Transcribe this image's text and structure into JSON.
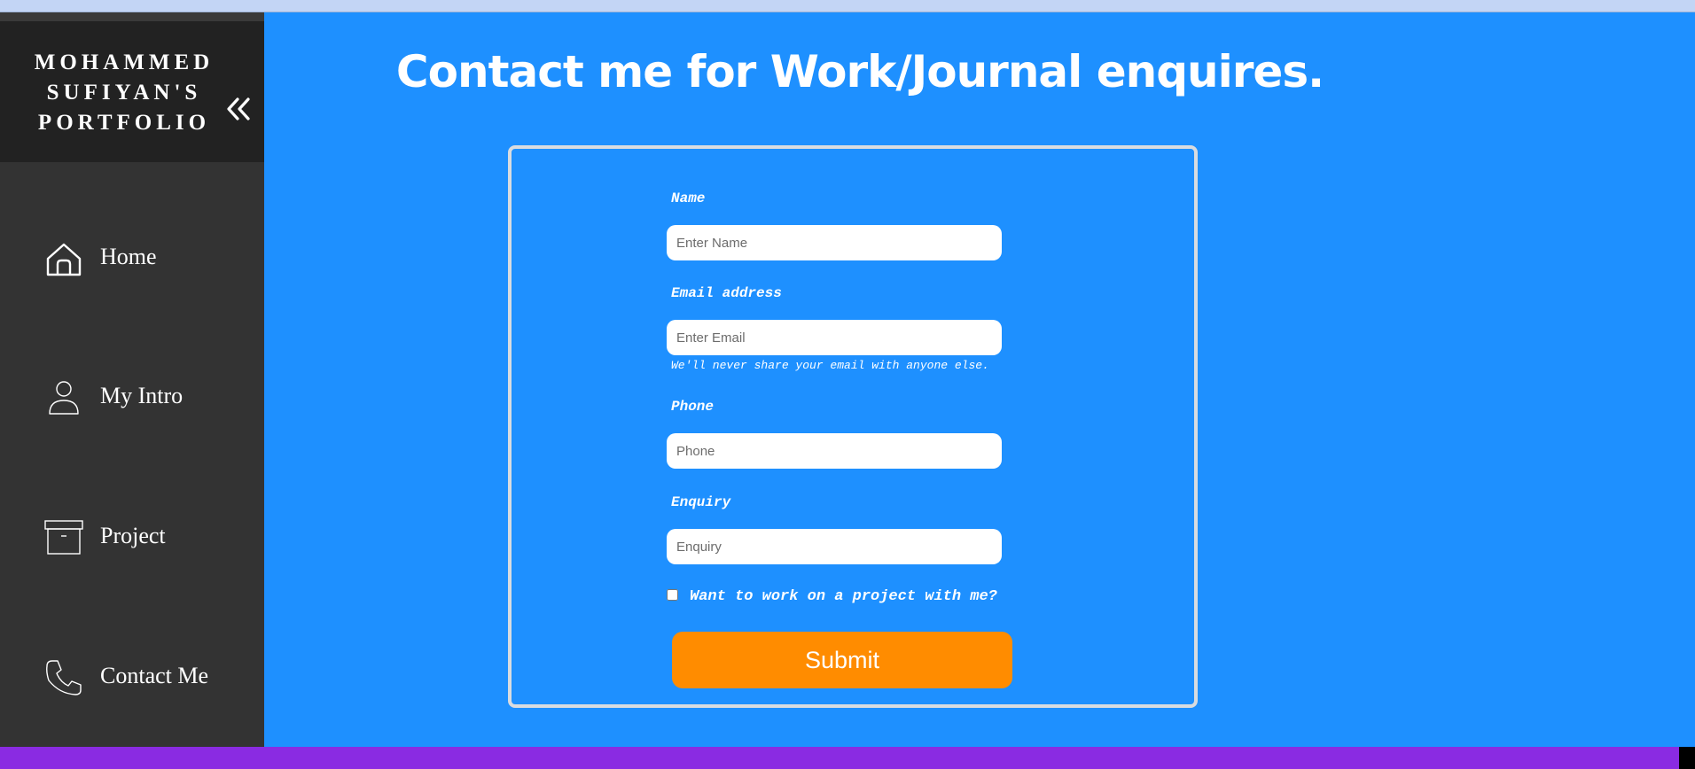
{
  "sidebar": {
    "brand_title": "MOHAMMED\nSUFIYAN'S\nPORTFOLIO",
    "collapse_icon": "double-chevron-left-icon",
    "items": [
      {
        "label": "Home",
        "icon": "home-icon"
      },
      {
        "label": "My Intro",
        "icon": "user-icon"
      },
      {
        "label": "Project",
        "icon": "archive-box-icon"
      },
      {
        "label": "Contact Me",
        "icon": "phone-icon"
      }
    ]
  },
  "main": {
    "title": "Contact me for Work/Journal enquires."
  },
  "form": {
    "name_label": "Name",
    "name_placeholder": "Enter Name",
    "email_label": "Email address",
    "email_placeholder": "Enter Email",
    "email_help": "We'll never share your email with anyone else.",
    "phone_label": "Phone",
    "phone_placeholder": "Phone",
    "enquiry_label": "Enquiry",
    "enquiry_placeholder": "Enquiry",
    "checkbox_label": "Want to work on a project with me?",
    "submit_label": "Submit"
  },
  "colors": {
    "background": "#1e90ff",
    "sidebar": "#333333",
    "brand_bg": "#222222",
    "submit": "#ff8c00",
    "footer": "#8a2be2"
  }
}
